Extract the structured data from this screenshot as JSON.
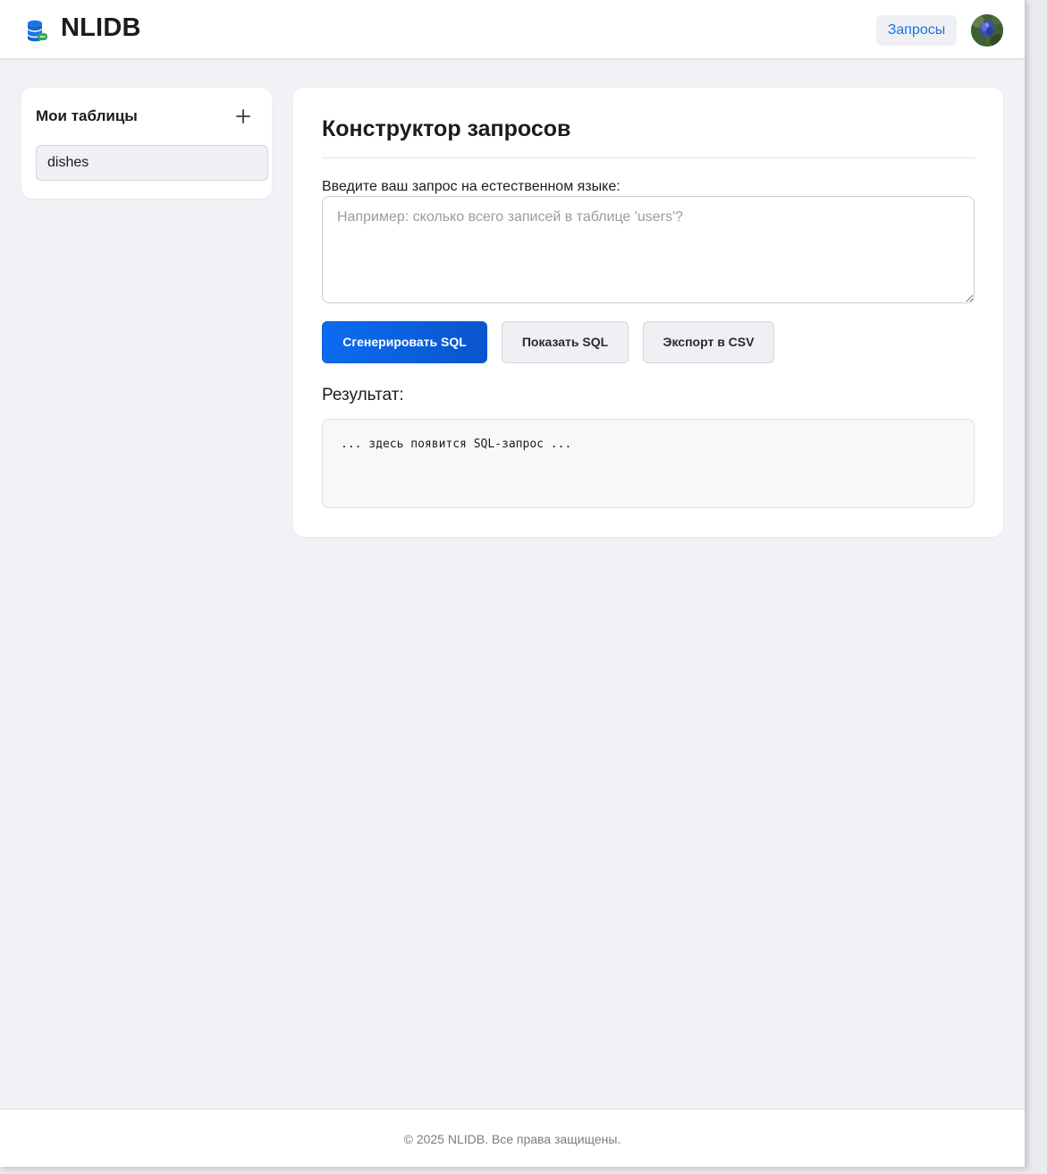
{
  "header": {
    "brand": "NLIDB",
    "logo_icon": "database-chat-icon",
    "nav_queries_label": "Запросы",
    "avatar_icon": "user-avatar"
  },
  "sidebar": {
    "title": "Мои таблицы",
    "add_icon": "plus-icon",
    "tables": [
      "dishes"
    ]
  },
  "main": {
    "title": "Конструктор запросов",
    "query_label": "Введите ваш запрос на естественном языке:",
    "query_value": "",
    "query_placeholder": "Например: сколько всего записей в таблице 'users'?",
    "buttons": {
      "generate": "Сгенерировать SQL",
      "show": "Показать SQL",
      "export": "Экспорт в CSV"
    },
    "result_label": "Результат:",
    "result_text": "... здесь появится SQL-запрос ..."
  },
  "footer": {
    "text": "© 2025 NLIDB. Все права защищены."
  },
  "colors": {
    "accent": "#0b6cf0",
    "link": "#1a73e8",
    "page_bg": "#f0f2f5"
  }
}
